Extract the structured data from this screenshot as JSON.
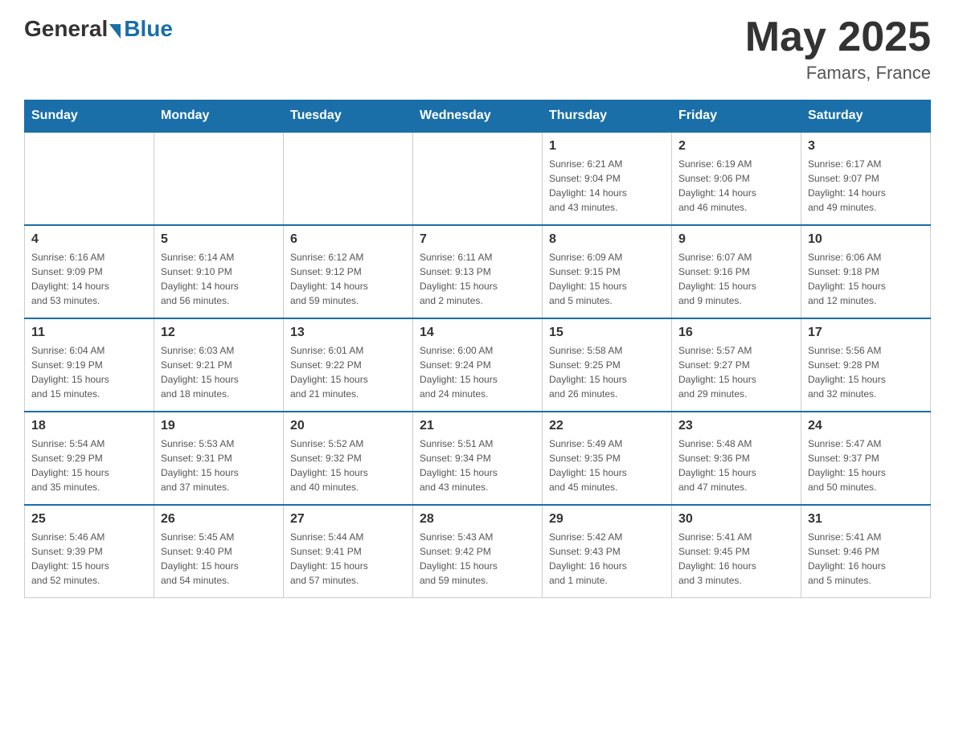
{
  "header": {
    "logo_general": "General",
    "logo_blue": "Blue",
    "month_year": "May 2025",
    "location": "Famars, France"
  },
  "weekdays": [
    "Sunday",
    "Monday",
    "Tuesday",
    "Wednesday",
    "Thursday",
    "Friday",
    "Saturday"
  ],
  "weeks": [
    [
      {
        "day": "",
        "info": ""
      },
      {
        "day": "",
        "info": ""
      },
      {
        "day": "",
        "info": ""
      },
      {
        "day": "",
        "info": ""
      },
      {
        "day": "1",
        "info": "Sunrise: 6:21 AM\nSunset: 9:04 PM\nDaylight: 14 hours\nand 43 minutes."
      },
      {
        "day": "2",
        "info": "Sunrise: 6:19 AM\nSunset: 9:06 PM\nDaylight: 14 hours\nand 46 minutes."
      },
      {
        "day": "3",
        "info": "Sunrise: 6:17 AM\nSunset: 9:07 PM\nDaylight: 14 hours\nand 49 minutes."
      }
    ],
    [
      {
        "day": "4",
        "info": "Sunrise: 6:16 AM\nSunset: 9:09 PM\nDaylight: 14 hours\nand 53 minutes."
      },
      {
        "day": "5",
        "info": "Sunrise: 6:14 AM\nSunset: 9:10 PM\nDaylight: 14 hours\nand 56 minutes."
      },
      {
        "day": "6",
        "info": "Sunrise: 6:12 AM\nSunset: 9:12 PM\nDaylight: 14 hours\nand 59 minutes."
      },
      {
        "day": "7",
        "info": "Sunrise: 6:11 AM\nSunset: 9:13 PM\nDaylight: 15 hours\nand 2 minutes."
      },
      {
        "day": "8",
        "info": "Sunrise: 6:09 AM\nSunset: 9:15 PM\nDaylight: 15 hours\nand 5 minutes."
      },
      {
        "day": "9",
        "info": "Sunrise: 6:07 AM\nSunset: 9:16 PM\nDaylight: 15 hours\nand 9 minutes."
      },
      {
        "day": "10",
        "info": "Sunrise: 6:06 AM\nSunset: 9:18 PM\nDaylight: 15 hours\nand 12 minutes."
      }
    ],
    [
      {
        "day": "11",
        "info": "Sunrise: 6:04 AM\nSunset: 9:19 PM\nDaylight: 15 hours\nand 15 minutes."
      },
      {
        "day": "12",
        "info": "Sunrise: 6:03 AM\nSunset: 9:21 PM\nDaylight: 15 hours\nand 18 minutes."
      },
      {
        "day": "13",
        "info": "Sunrise: 6:01 AM\nSunset: 9:22 PM\nDaylight: 15 hours\nand 21 minutes."
      },
      {
        "day": "14",
        "info": "Sunrise: 6:00 AM\nSunset: 9:24 PM\nDaylight: 15 hours\nand 24 minutes."
      },
      {
        "day": "15",
        "info": "Sunrise: 5:58 AM\nSunset: 9:25 PM\nDaylight: 15 hours\nand 26 minutes."
      },
      {
        "day": "16",
        "info": "Sunrise: 5:57 AM\nSunset: 9:27 PM\nDaylight: 15 hours\nand 29 minutes."
      },
      {
        "day": "17",
        "info": "Sunrise: 5:56 AM\nSunset: 9:28 PM\nDaylight: 15 hours\nand 32 minutes."
      }
    ],
    [
      {
        "day": "18",
        "info": "Sunrise: 5:54 AM\nSunset: 9:29 PM\nDaylight: 15 hours\nand 35 minutes."
      },
      {
        "day": "19",
        "info": "Sunrise: 5:53 AM\nSunset: 9:31 PM\nDaylight: 15 hours\nand 37 minutes."
      },
      {
        "day": "20",
        "info": "Sunrise: 5:52 AM\nSunset: 9:32 PM\nDaylight: 15 hours\nand 40 minutes."
      },
      {
        "day": "21",
        "info": "Sunrise: 5:51 AM\nSunset: 9:34 PM\nDaylight: 15 hours\nand 43 minutes."
      },
      {
        "day": "22",
        "info": "Sunrise: 5:49 AM\nSunset: 9:35 PM\nDaylight: 15 hours\nand 45 minutes."
      },
      {
        "day": "23",
        "info": "Sunrise: 5:48 AM\nSunset: 9:36 PM\nDaylight: 15 hours\nand 47 minutes."
      },
      {
        "day": "24",
        "info": "Sunrise: 5:47 AM\nSunset: 9:37 PM\nDaylight: 15 hours\nand 50 minutes."
      }
    ],
    [
      {
        "day": "25",
        "info": "Sunrise: 5:46 AM\nSunset: 9:39 PM\nDaylight: 15 hours\nand 52 minutes."
      },
      {
        "day": "26",
        "info": "Sunrise: 5:45 AM\nSunset: 9:40 PM\nDaylight: 15 hours\nand 54 minutes."
      },
      {
        "day": "27",
        "info": "Sunrise: 5:44 AM\nSunset: 9:41 PM\nDaylight: 15 hours\nand 57 minutes."
      },
      {
        "day": "28",
        "info": "Sunrise: 5:43 AM\nSunset: 9:42 PM\nDaylight: 15 hours\nand 59 minutes."
      },
      {
        "day": "29",
        "info": "Sunrise: 5:42 AM\nSunset: 9:43 PM\nDaylight: 16 hours\nand 1 minute."
      },
      {
        "day": "30",
        "info": "Sunrise: 5:41 AM\nSunset: 9:45 PM\nDaylight: 16 hours\nand 3 minutes."
      },
      {
        "day": "31",
        "info": "Sunrise: 5:41 AM\nSunset: 9:46 PM\nDaylight: 16 hours\nand 5 minutes."
      }
    ]
  ]
}
